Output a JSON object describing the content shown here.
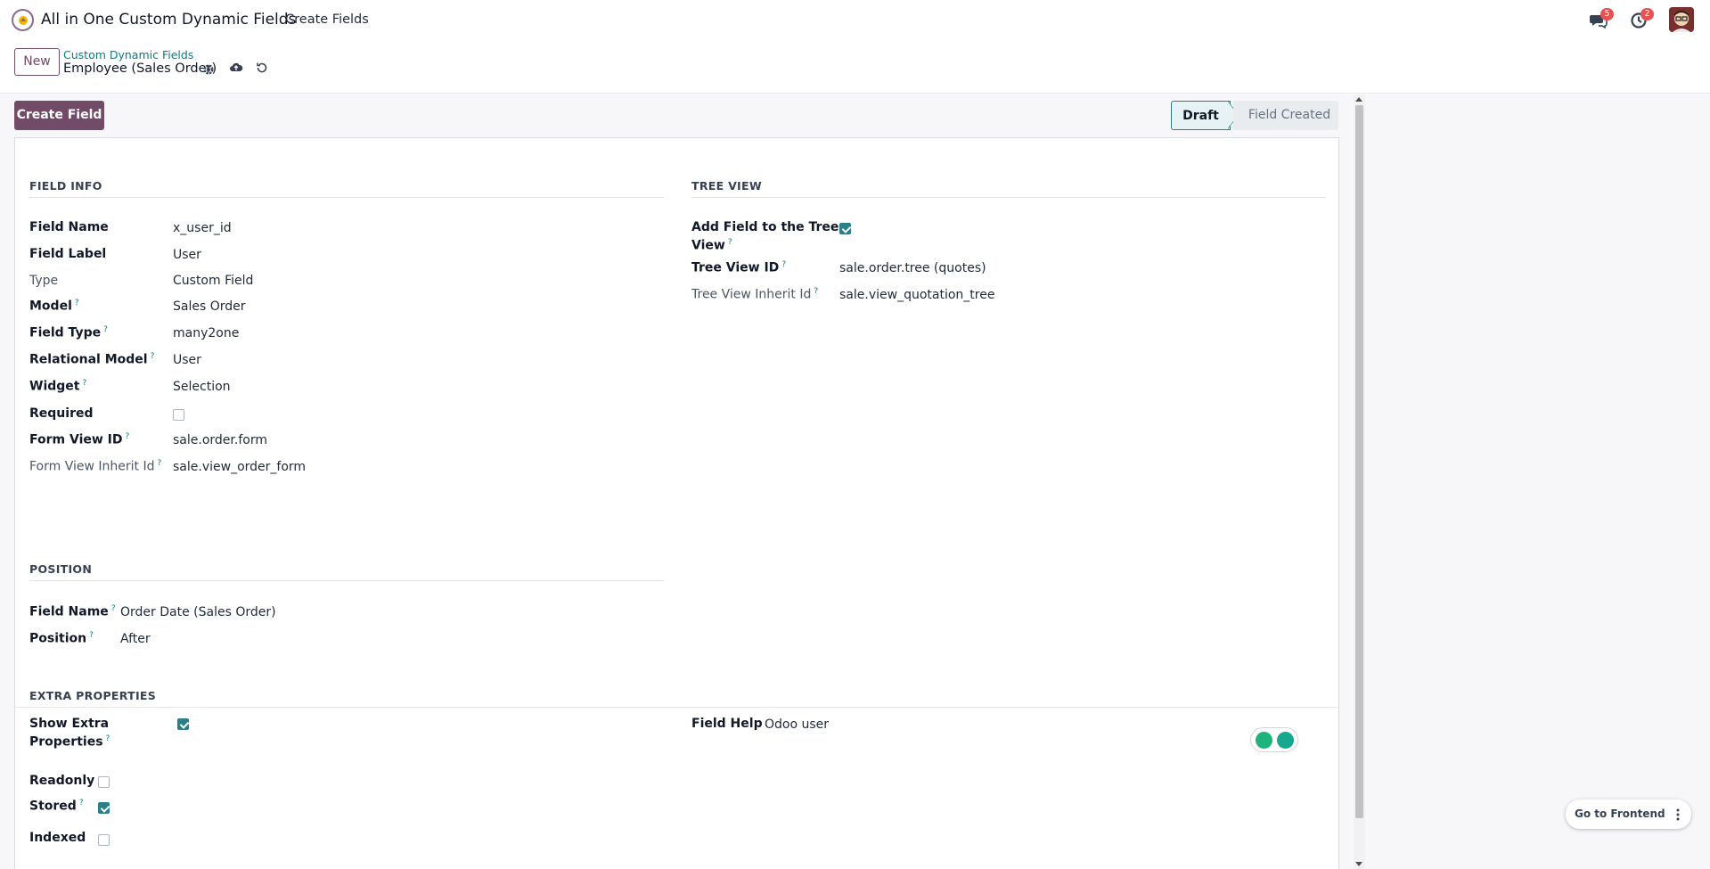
{
  "navbar": {
    "app_name": "All in One Custom Dynamic Fields",
    "menu_create_fields": "Create Fields",
    "messages_count": "5",
    "activities_count": "2"
  },
  "control_panel": {
    "new_label": "New",
    "breadcrumb_parent": "Custom Dynamic Fields",
    "record_name": "Employee (Sales Order)"
  },
  "statusbar": {
    "create_field_label": "Create Field",
    "stages": [
      "Draft",
      "Field Created"
    ],
    "active_stage": "Draft"
  },
  "field_info": {
    "title": "FIELD INFO",
    "rows": [
      {
        "label": "Field Name",
        "value": "x_user_id",
        "help": false,
        "light": false
      },
      {
        "label": "Field Label",
        "value": "User",
        "help": false,
        "light": false
      },
      {
        "label": "Type",
        "value": "Custom Field",
        "help": false,
        "light": true
      },
      {
        "label": "Model",
        "value": "Sales Order",
        "help": true,
        "light": false
      },
      {
        "label": "Field Type",
        "value": "many2one",
        "help": true,
        "light": false
      },
      {
        "label": "Relational Model",
        "value": "User",
        "help": true,
        "light": false
      },
      {
        "label": "Widget",
        "value": "Selection",
        "help": true,
        "light": false
      },
      {
        "label": "Required",
        "value": "",
        "help": false,
        "light": false
      },
      {
        "label": "Form View ID",
        "value": "sale.order.form",
        "help": true,
        "light": false
      },
      {
        "label": "Form View Inherit Id",
        "value": "sale.view_order_form",
        "help": true,
        "light": true
      }
    ],
    "required_checked": false
  },
  "tree_view": {
    "title": "TREE VIEW",
    "add_field_label_line1": "Add Field to the Tree",
    "add_field_label_line2": "View",
    "add_field_checked": true,
    "tree_view_id_label": "Tree View ID",
    "tree_view_id_value": "sale.order.tree (quotes)",
    "tree_inherit_label": "Tree View Inherit Id",
    "tree_inherit_value": "sale.view_quotation_tree"
  },
  "position": {
    "title": "POSITION",
    "field_name_label": "Field Name",
    "field_name_value": "Order Date (Sales Order)",
    "position_label": "Position",
    "position_value": "After"
  },
  "extra_properties": {
    "title": "EXTRA PROPERTIES",
    "show_extra_line1": "Show Extra",
    "show_extra_line2": "Properties",
    "show_extra_checked": true,
    "readonly_label": "Readonly",
    "readonly_checked": false,
    "stored_label": "Stored",
    "stored_checked": true,
    "indexed_label": "Indexed",
    "indexed_checked": false,
    "field_help_label": "Field Help",
    "field_help_value": "Odoo user"
  },
  "help_mark": "?",
  "floating": {
    "goto_frontend_label": "Go to Frontend"
  },
  "colors": {
    "brand": "#714b67",
    "accent": "#017e84",
    "check": "#2b7f86",
    "badge": "#e55353"
  }
}
